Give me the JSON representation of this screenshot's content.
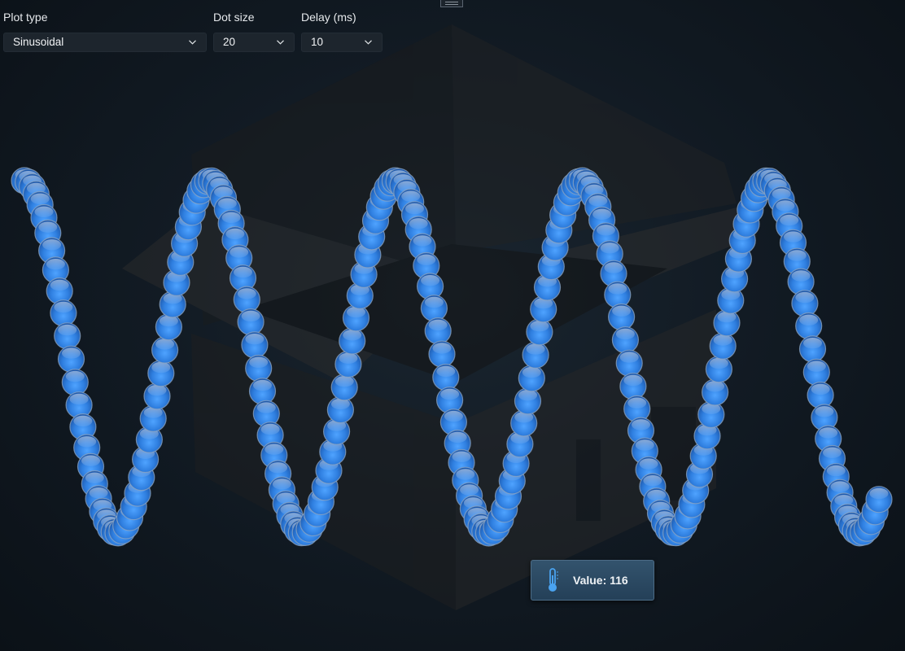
{
  "controls": {
    "plot_type": {
      "label": "Plot type",
      "value": "Sinusoidal"
    },
    "dot_size": {
      "label": "Dot size",
      "value": "20"
    },
    "delay": {
      "label": "Delay (ms)",
      "value": "10"
    }
  },
  "tooltip": {
    "label": "Value: 116",
    "icon": "thermometer-icon"
  },
  "colors": {
    "dot_main": "#3a87e0",
    "dot_dark": "#1d4f9a",
    "dot_highlight": "#bfe0ff",
    "dot_outline": "#8ea6c2",
    "background": "#101820"
  },
  "chart_data": {
    "type": "scatter",
    "series": [
      {
        "y_min": 0,
        "y_max": 116,
        "cycles": 4.6,
        "point_count": 220
      }
    ]
  }
}
